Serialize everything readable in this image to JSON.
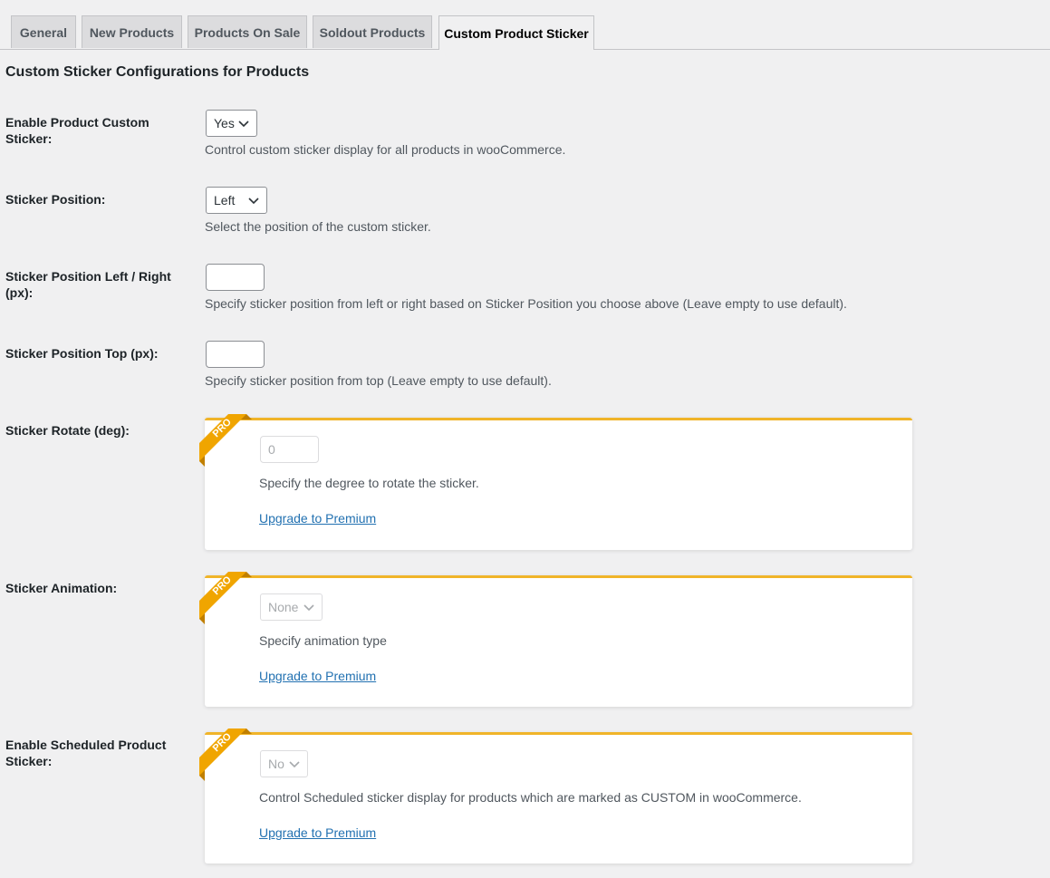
{
  "tabs": [
    {
      "label": "General"
    },
    {
      "label": "New Products"
    },
    {
      "label": "Products On Sale"
    },
    {
      "label": "Soldout Products"
    },
    {
      "label": "Custom Product Sticker"
    }
  ],
  "active_tab": "Custom Product Sticker",
  "section_title": "Custom Sticker Configurations for Products",
  "fields": {
    "enable": {
      "label": "Enable Product Custom Sticker:",
      "value": "Yes",
      "description": "Control custom sticker display for all products in wooCommerce."
    },
    "position": {
      "label": "Sticker Position:",
      "value": "Left",
      "description": "Select the position of the custom sticker."
    },
    "left_right": {
      "label": "Sticker Position Left / Right (px):",
      "value": "",
      "description": "Specify sticker position from left or right based on Sticker Position you choose above (Leave empty to use default)."
    },
    "top": {
      "label": "Sticker Position Top (px):",
      "value": "",
      "description": "Specify sticker position from top (Leave empty to use default)."
    },
    "rotate": {
      "label": "Sticker Rotate (deg):",
      "value": "0",
      "description": "Specify the degree to rotate the sticker.",
      "link": "Upgrade to Premium",
      "badge": "PRO"
    },
    "animation": {
      "label": "Sticker Animation:",
      "value": "None",
      "description": "Specify animation type",
      "link": "Upgrade to Premium",
      "badge": "PRO"
    },
    "scheduled": {
      "label": "Enable Scheduled Product Sticker:",
      "value": "No",
      "description": "Control Scheduled sticker display for products which are marked as CUSTOM in wooCommerce.",
      "link": "Upgrade to Premium",
      "badge": "PRO"
    }
  },
  "colors": {
    "badge": "#f0a500",
    "link": "#2271b1",
    "background": "#f0f0f1"
  },
  "icons": {
    "select_arrow": "chevron-down-icon",
    "pro_badge": "pro-ribbon-icon"
  }
}
